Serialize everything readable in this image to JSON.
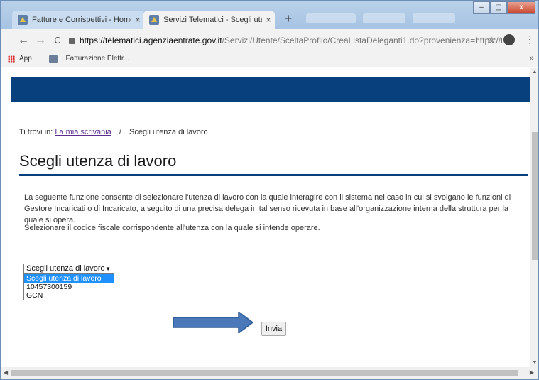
{
  "browser": {
    "tabs": [
      {
        "title": "Fatture e Corrispettivi - Home",
        "close": "×"
      },
      {
        "title": "Servizi Telematici - Scegli utenza",
        "close": "×"
      }
    ],
    "new_tab": "+",
    "window_buttons": {
      "minimize": "–",
      "maximize": "▢",
      "close": "x"
    },
    "nav": {
      "back": "←",
      "forward": "→",
      "reload": "C"
    },
    "url_host": "https://telematici.agenziaentrate.gov.it",
    "url_path": "/Servizi/Utente/SceltaProfilo/CreaListaDeleganti1.do?provenienza=https://telem...",
    "star": "☆",
    "menu": "⋮",
    "bookmarks": [
      {
        "label": "App"
      },
      {
        "label": "..Fatturazione Elettr..."
      }
    ],
    "bookmarks_more": "»"
  },
  "page": {
    "breadcrumb": {
      "prefix": "Ti trovi in:",
      "link": "La mia scrivania",
      "separator": "/",
      "current": "Scegli utenza di lavoro"
    },
    "title": "Scegli utenza di lavoro",
    "description": "La seguente funzione consente di selezionare l'utenza di lavoro con la quale interagire con il sistema nel caso in cui si svolgano le funzioni di Gestore Incaricati o di Incaricato, a seguito di una precisa delega in tal senso ricevuta in base all'organizzazione interna della struttura per la quale si opera.",
    "instruction": "Selezionare il codice fiscale corrispondente all'utenza con la quale si intende operare.",
    "select": {
      "value": "Scegli utenza di lavoro",
      "options": [
        "Scegli utenza di lavoro",
        "10457300159",
        "GCN"
      ]
    },
    "submit_label": "Invia"
  },
  "colors": {
    "brand_blue": "#07407d",
    "arrow_fill": "#4a78b8",
    "selected_option": "#1e90ff"
  }
}
